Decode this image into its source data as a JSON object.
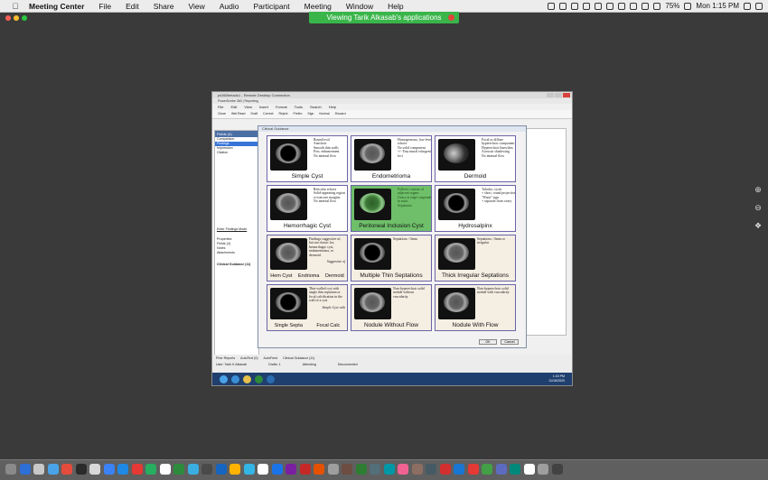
{
  "menubar": {
    "app_name": "Meeting Center",
    "items": [
      "File",
      "Edit",
      "Share",
      "View",
      "Audio",
      "Participant",
      "Meeting",
      "Window",
      "Help"
    ],
    "battery": "75%",
    "clock": "Mon 1:15 PM"
  },
  "share_banner": "Viewing Tarik Alkasab's applications",
  "remote_window": {
    "title": "ps360beta4s1 - Remote Desktop Connection",
    "app_title": "PowerScribe 360 | Reporting",
    "menu": [
      "File",
      "Edit",
      "View",
      "Insert",
      "Format",
      "Tools",
      "Search",
      "Help"
    ],
    "toolbar": [
      "Close",
      "Wet Read",
      "Draft",
      "Correct",
      "Reject",
      "Prelim",
      "Sign",
      "Normal",
      "Discard"
    ],
    "left_panel": {
      "header": "Fields (4)",
      "items": [
        "Comparison",
        "Findings",
        "Impression",
        "Citation"
      ],
      "enter_findings_mode": "Enter Findings Mode",
      "sections": [
        "Properties",
        "Fields (4)",
        "Notes",
        "Attachments",
        "Clinical Guidance (11)"
      ]
    },
    "bottom_tabs": [
      "Prior Reports",
      "AutoText (0)",
      "AutoFeed",
      "Clinical Guidance (11)"
    ],
    "status": {
      "user": "User: Tarik K Alkasab",
      "drafts": "Drafts: 1",
      "attending": "Attending",
      "disconnected": "Disconnected"
    },
    "taskbar_clock": [
      "1:15 PM",
      "11/16/2020"
    ]
  },
  "dialog": {
    "title": "Clinical Guidance",
    "cards": [
      {
        "label": "Simple Cyst",
        "bullets": [
          "Round/oval",
          "Anechoic",
          "Smooth thin walls",
          "Post. enhancement",
          "No internal flow"
        ],
        "style": "white",
        "img": "cyst"
      },
      {
        "label": "Endometrioma",
        "bullets": [
          "Homogeneous, low-level echoes",
          "No solid component",
          "+/- Tiny mural echogenic foci"
        ],
        "style": "white",
        "img": "hazy"
      },
      {
        "label": "Dermoid",
        "bullets": [
          "Focal or diffuse hyperechoic component",
          "Hyperechoic lines/dots",
          "Acoustic shadowing",
          "No internal flow"
        ],
        "style": "white",
        "img": "bright"
      },
      {
        "label": "Hemorrhagic Cyst",
        "bullets": [
          "Reticular echoes",
          "Solid-appearing region w/concave margins",
          "No internal flow"
        ],
        "style": "white",
        "img": "hazy"
      },
      {
        "label": "Peritoneal Inclusion Cyst",
        "bullets": [
          "Follows contour of adjacent organs",
          "Ovary at edge/ suspended in mass",
          "Septations"
        ],
        "style": "green",
        "img": "green"
      },
      {
        "label": "Hydrosalpinx",
        "bullets": [
          "Tubular, cystic",
          "+ short, round projections",
          "\"Waist\" sign",
          "+ separate from ovary"
        ],
        "style": "white",
        "img": "cyst"
      },
      {
        "label_parts": [
          "Hem Cyst",
          "Endrioma",
          "Dermoid"
        ],
        "text": [
          "Findings suggestive of, but not classic for, hemorrhagic cyst, endometrioma, or dermoid."
        ],
        "italic": "Suggestive of",
        "style": "warm",
        "img": "hazy"
      },
      {
        "label": "Multiple Thin Septations",
        "text": [
          "Septations <3mm"
        ],
        "style": "warm",
        "img": "cyst"
      },
      {
        "label": "Thick Irregular Septations",
        "text": [
          "Septations >3mm or irregular"
        ],
        "style": "warm",
        "img": "hazy"
      },
      {
        "label": "Single Septa",
        "label2": "Focal Calc",
        "text": [
          "Thin-walled cyst with single thin septation or focal calcification in the wall of a cyst"
        ],
        "italic": "Simple Cyst with",
        "style": "warm",
        "img": "cyst"
      },
      {
        "label": "Nodule Without Flow",
        "text": [
          "Non-hyperechoic solid nodule without vascularity"
        ],
        "style": "warm",
        "img": "hazy"
      },
      {
        "label": "Nodule With Flow",
        "text": [
          "Non-hyperechoic solid nodule with vascularity"
        ],
        "style": "warm",
        "img": "hazy"
      }
    ],
    "ok": "OK",
    "cancel": "Cancel"
  },
  "dock_colors": [
    "#8a8a8a",
    "#2d6fd6",
    "#c8c8c8",
    "#4aa3e8",
    "#e34b3c",
    "#2b2b2b",
    "#d8d8d8",
    "#3b82f6",
    "#1e88e5",
    "#e53935",
    "#27ae60",
    "#ffffff",
    "#2c8c3c",
    "#3aaee0",
    "#4a4a4a",
    "#1565c0",
    "#ffb300",
    "#33b5e5",
    "#ffffff",
    "#1a73e8",
    "#7b1fa2",
    "#c62828",
    "#e65100",
    "#9e9e9e",
    "#6d4c41",
    "#2e7d32",
    "#546e7a",
    "#0097a7",
    "#f06292",
    "#8d6e63",
    "#455a64",
    "#d32f2f",
    "#1976d2",
    "#e53935",
    "#43a047",
    "#5c6bc0",
    "#00897b",
    "#ffffff",
    "#9e9e9e",
    "#424242"
  ]
}
